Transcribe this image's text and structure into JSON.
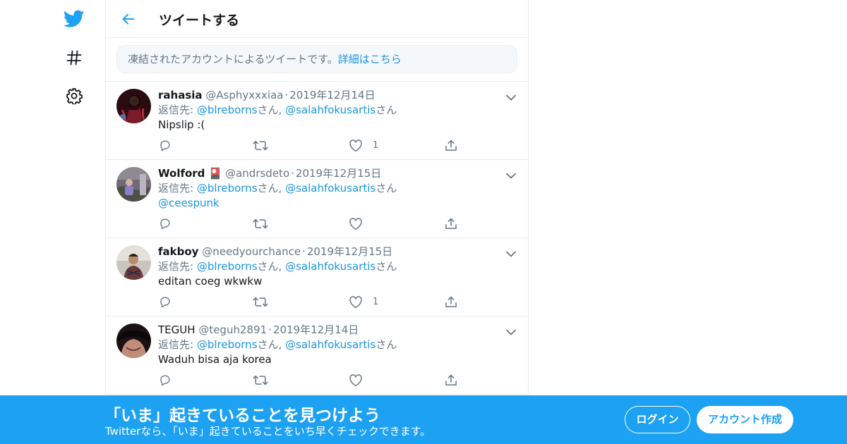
{
  "header": {
    "title": "ツイートする"
  },
  "notice": {
    "text": "凍結されたアカウントによるツイートです。",
    "link": "詳細はこちら"
  },
  "reply_prefix": "返信先: ",
  "reply_suffix": "さん",
  "reply_sep": ", ",
  "tweets": [
    {
      "name": "rahasia",
      "handle": "@Asphyxxxiaa",
      "date": "2019年12月14日",
      "mention1": "@blreborns",
      "mention2": "@salahfokusartis",
      "mention3": "",
      "text": "Nipslip :(",
      "likes": "1"
    },
    {
      "name": "Wolford 🎴",
      "handle": "@andrsdeto",
      "date": "2019年12月15日",
      "mention1": "@blreborns",
      "mention2": "@salahfokusartis",
      "mention3": "@ceespunk",
      "text": "",
      "likes": ""
    },
    {
      "name": "fakboy",
      "handle": "@needyourchance",
      "date": "2019年12月15日",
      "mention1": "@blreborns",
      "mention2": "@salahfokusartis",
      "mention3": "",
      "text": "editan coeg wkwkw",
      "likes": "1"
    },
    {
      "name": "TEGUH",
      "handle": "@teguh2891",
      "date": "2019年12月14日",
      "mention1": "@blreborns",
      "mention2": "@salahfokusartis",
      "mention3": "",
      "text": "Waduh bisa aja korea",
      "likes": ""
    }
  ],
  "banner": {
    "title": "「いま」起きていることを見つけよう",
    "subtitle": "Twitterなら、「いま」起きていることをいち早くチェックできます。",
    "login": "ログイン",
    "signup": "アカウント作成"
  },
  "colors": {
    "accent": "#1da1f2",
    "link": "#1b95e0",
    "muted": "#657786"
  },
  "icons": [
    "twitter-bird-icon",
    "hashtag-icon",
    "gear-icon",
    "back-arrow-icon",
    "chevron-down-icon",
    "reply-icon",
    "retweet-icon",
    "heart-icon",
    "share-icon"
  ]
}
